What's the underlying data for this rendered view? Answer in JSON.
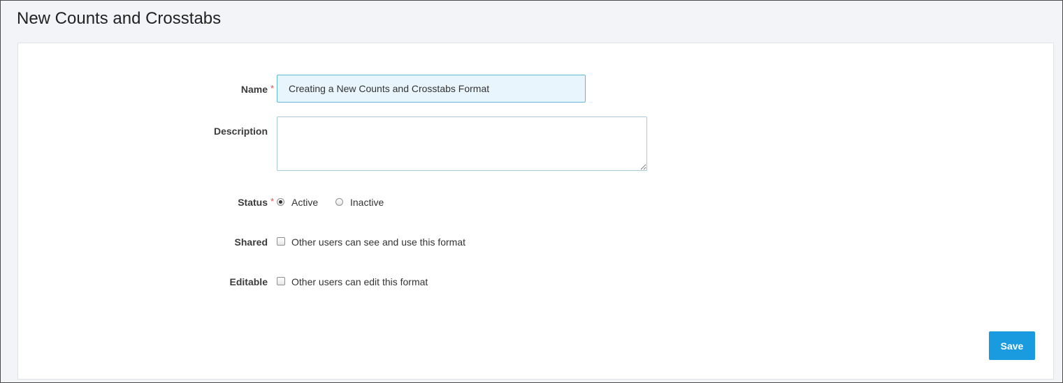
{
  "page": {
    "title": "New Counts and Crosstabs"
  },
  "form": {
    "name": {
      "label": "Name",
      "required_marker": "*",
      "value": "Creating a New Counts and Crosstabs Format"
    },
    "description": {
      "label": "Description",
      "value": ""
    },
    "status": {
      "label": "Status",
      "required_marker": "*",
      "options": [
        {
          "label": "Active",
          "selected": true
        },
        {
          "label": "Inactive",
          "selected": false
        }
      ]
    },
    "shared": {
      "label": "Shared",
      "checkbox_label": "Other users can see and use this format",
      "checked": false
    },
    "editable": {
      "label": "Editable",
      "checkbox_label": "Other users can edit this format",
      "checked": false
    }
  },
  "actions": {
    "save_label": "Save"
  },
  "colors": {
    "accent": "#1a9be0",
    "required": "#e05252",
    "name_input_bg": "#e8f5fc",
    "name_input_border": "#5fb9d6",
    "page_bg": "#f3f4f7"
  }
}
